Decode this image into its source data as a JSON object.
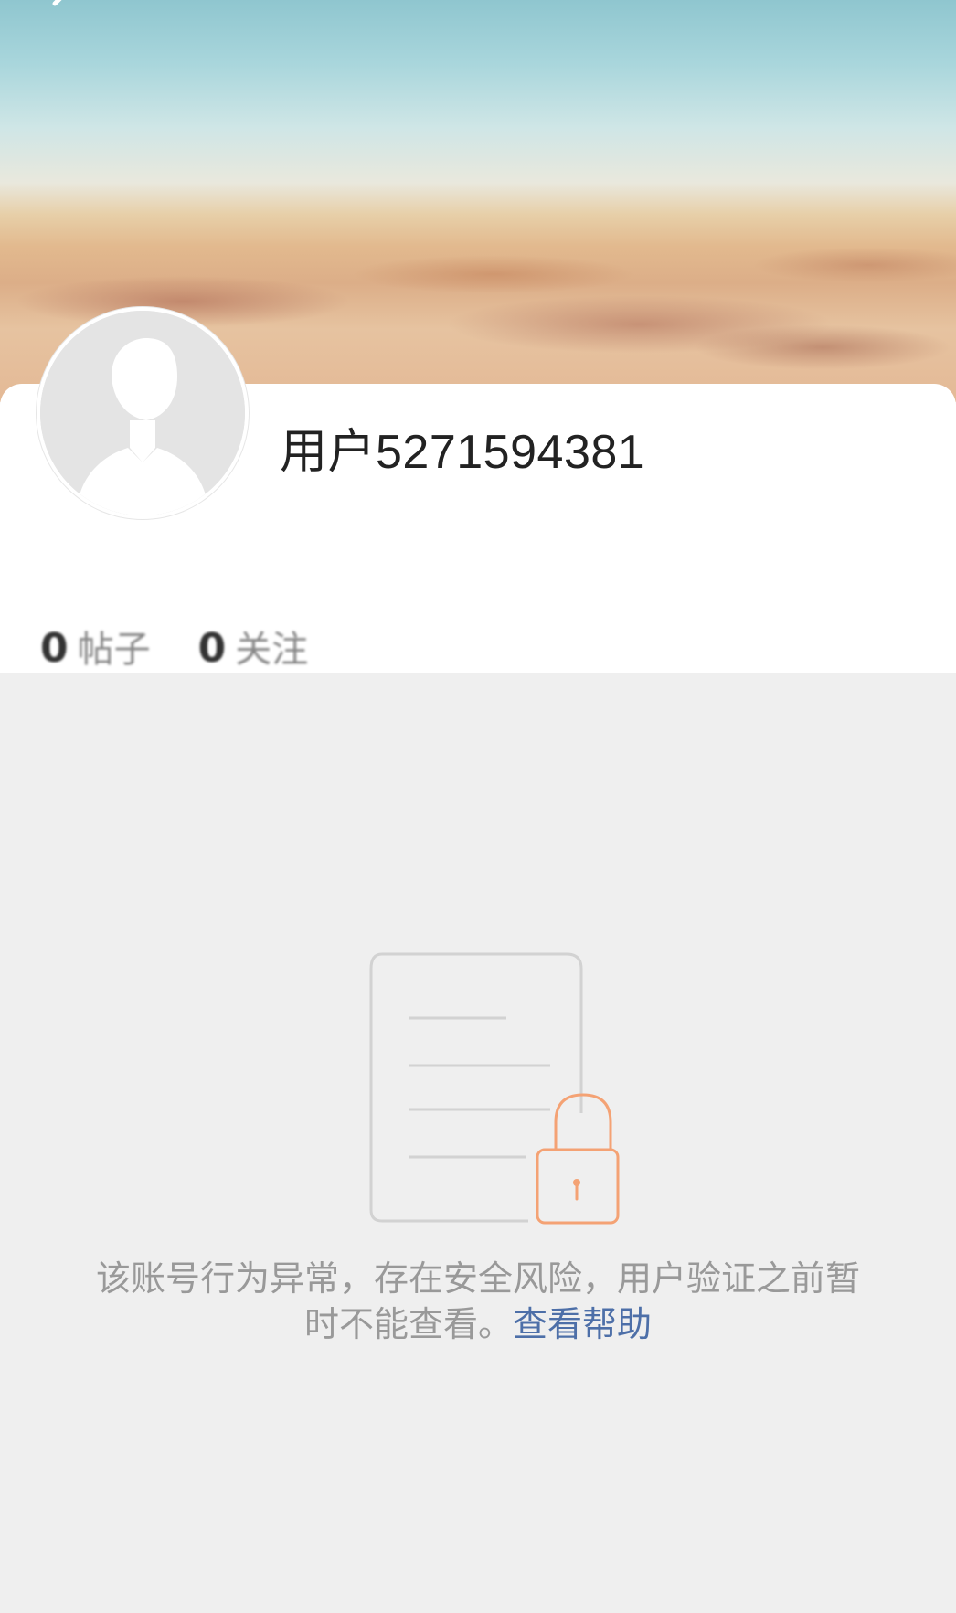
{
  "profile": {
    "username": "用户5271594381"
  },
  "stats": [
    {
      "value": "0",
      "label": "帖子"
    },
    {
      "value": "0",
      "label": "关注"
    }
  ],
  "notice": {
    "text": "该账号行为异常，存在安全风险，用户验证之前暂时不能查看。",
    "help_link": "查看帮助"
  },
  "icons": {
    "back": "back-arrow-icon",
    "lock_document": "locked-document-icon"
  },
  "colors": {
    "link": "#4d6fa8",
    "lock_accent": "#f4a274",
    "muted_text": "#999999",
    "background": "#efefef"
  }
}
